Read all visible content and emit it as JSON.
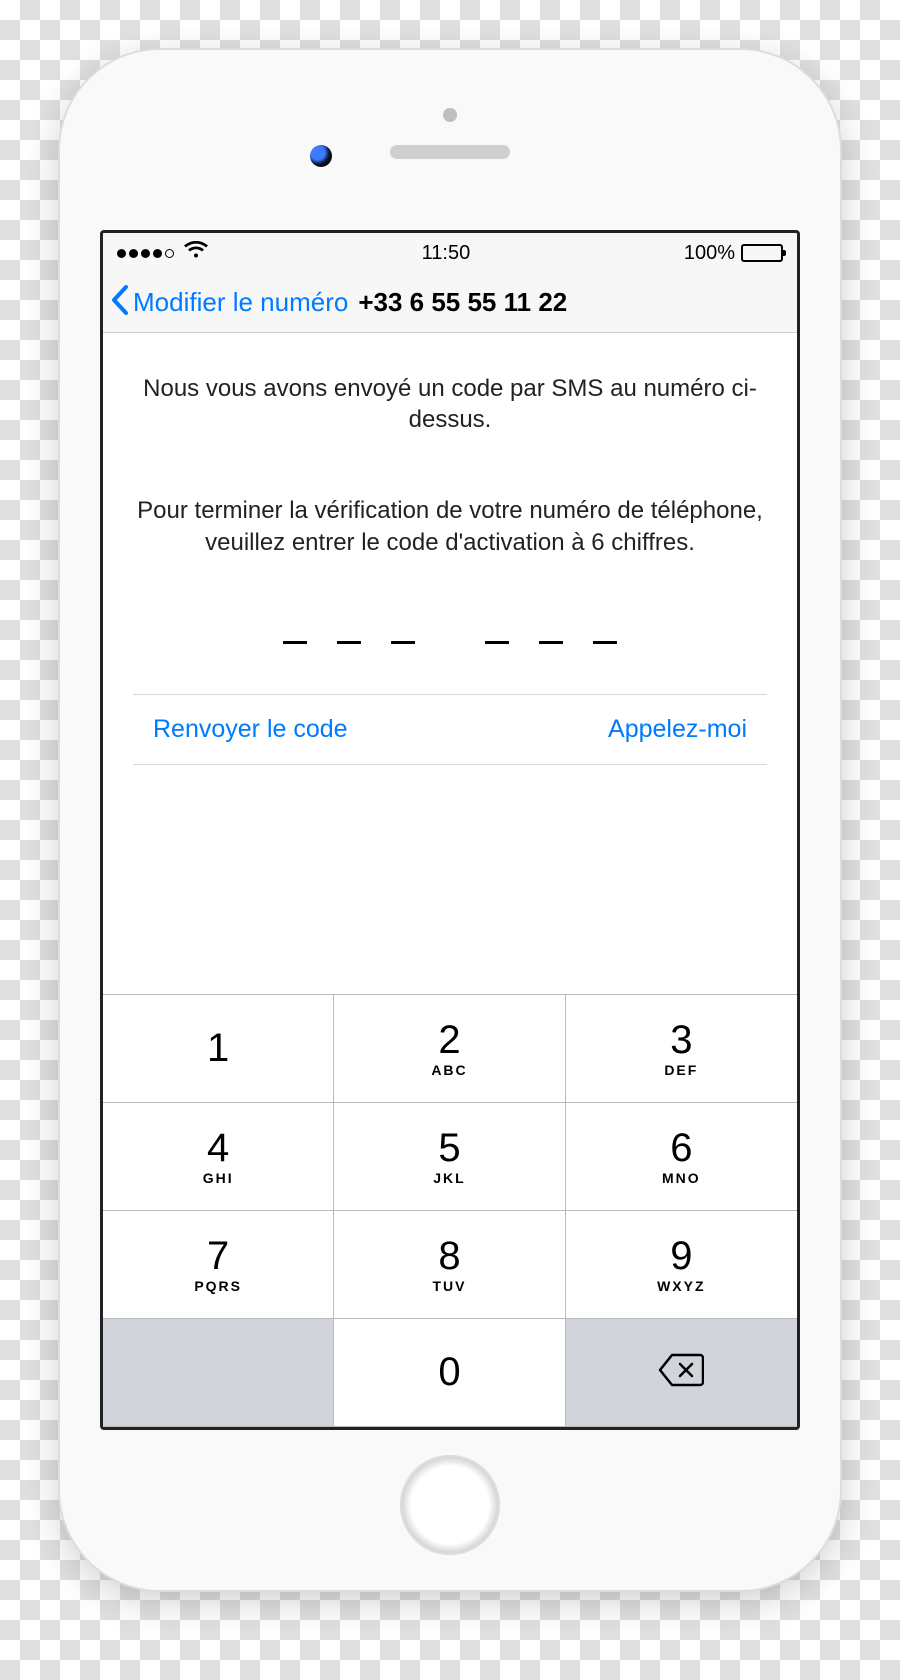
{
  "status": {
    "time": "11:50",
    "battery_pct": "100%"
  },
  "nav": {
    "back_label": "Modifier le numéro",
    "title": "+33 6 55 55 11 22"
  },
  "content": {
    "line1": "Nous vous avons envoyé un code par SMS au numéro ci-dessus.",
    "line2": "Pour terminer la vérification de votre numéro de téléphone, veuillez entrer le code d'activation à 6 chiffres."
  },
  "actions": {
    "resend": "Renvoyer le code",
    "callme": "Appelez-moi"
  },
  "keypad": {
    "k1": {
      "d": "1",
      "l": ""
    },
    "k2": {
      "d": "2",
      "l": "ABC"
    },
    "k3": {
      "d": "3",
      "l": "DEF"
    },
    "k4": {
      "d": "4",
      "l": "GHI"
    },
    "k5": {
      "d": "5",
      "l": "JKL"
    },
    "k6": {
      "d": "6",
      "l": "MNO"
    },
    "k7": {
      "d": "7",
      "l": "PQRS"
    },
    "k8": {
      "d": "8",
      "l": "TUV"
    },
    "k9": {
      "d": "9",
      "l": "WXYZ"
    },
    "k0": {
      "d": "0",
      "l": ""
    }
  }
}
